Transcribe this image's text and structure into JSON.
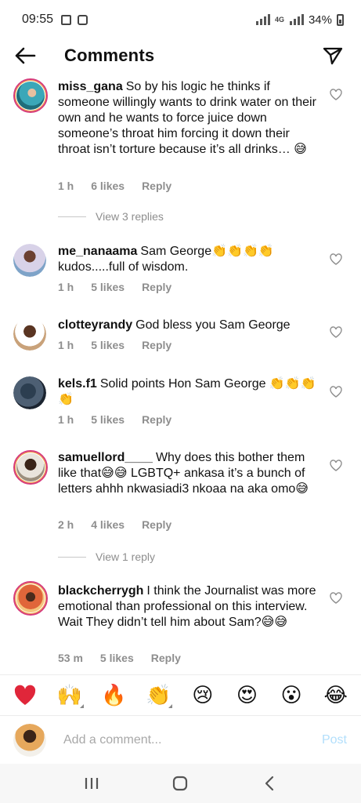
{
  "status_bar": {
    "time": "09:55",
    "network": "4G",
    "battery": "34%"
  },
  "header": {
    "title": "Comments"
  },
  "comments": [
    {
      "username": "miss_gana",
      "text": "So by his logic he thinks if someone willingly wants to drink water on their own and he wants to force juice down someone’s throat him forcing it down their throat isn’t torture because it’s all drinks… 😅",
      "time": "1 h",
      "likes": "6 likes",
      "reply": "Reply",
      "view_replies": "View 3 replies"
    },
    {
      "username": "me_nanaama",
      "text": "Sam George👏👏👏👏 kudos.....full of wisdom.",
      "time": "1 h",
      "likes": "5 likes",
      "reply": "Reply"
    },
    {
      "username": "clotteyrandy",
      "text": "God bless you Sam George",
      "time": "1 h",
      "likes": "5 likes",
      "reply": "Reply"
    },
    {
      "username": "kels.f1",
      "text": "Solid points Hon Sam George 👏👏👏👏",
      "time": "1 h",
      "likes": "5 likes",
      "reply": "Reply"
    },
    {
      "username": "samuellord____",
      "text": "Why does this bother them like that😅😅 LGBTQ+ ankasa it’s a bunch of letters ahhh nkwasiadi3 nkoaa na aka omo😅",
      "time": "2 h",
      "likes": "4 likes",
      "reply": "Reply",
      "view_replies": "View 1 reply"
    },
    {
      "username": "blackcherrygh",
      "text": "I think the Journalist was more emotional than professional on this interview.\nWait They didn’t tell him about Sam?😅😅",
      "time": "53 m",
      "likes": "5 likes",
      "reply": "Reply"
    }
  ],
  "emoji_bar": [
    "❤️",
    "🙌",
    "🔥",
    "👏",
    "😢",
    "😍",
    "😮",
    "😂"
  ],
  "comment_input": {
    "placeholder": "Add a comment...",
    "post_label": "Post"
  },
  "colors": {
    "accent_post": "#b2dffc",
    "muted": "#8e8e8e",
    "story_ring": "#d63b7c"
  }
}
